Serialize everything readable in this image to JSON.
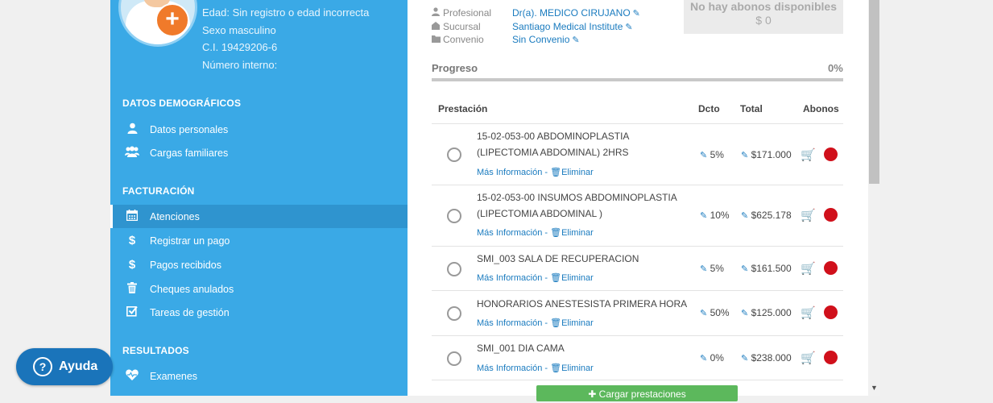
{
  "patient": {
    "edad": "Edad: Sin registro o edad incorrecta",
    "sexo": "Sexo masculino",
    "ci": "C.I. 19429206-6",
    "numero_interno": "Número interno:"
  },
  "sidebar": {
    "sections": [
      {
        "title": "DATOS DEMOGRÁFICOS"
      },
      {
        "title": "FACTURACIÓN"
      },
      {
        "title": "RESULTADOS"
      }
    ],
    "items": [
      {
        "label": "Datos personales",
        "icon": "user-icon"
      },
      {
        "label": "Cargas familiares",
        "icon": "users-icon"
      },
      {
        "label": "Atenciones",
        "icon": "calendar-icon",
        "active": true
      },
      {
        "label": "Registrar un pago",
        "icon": "dollar-icon"
      },
      {
        "label": "Pagos recibidos",
        "icon": "dollar-icon"
      },
      {
        "label": "Cheques anulados",
        "icon": "trash-icon"
      },
      {
        "label": "Tareas de gestión",
        "icon": "checkbox-icon"
      },
      {
        "label": "Examenes",
        "icon": "heartbeat-icon"
      }
    ]
  },
  "help": {
    "label": "Ayuda"
  },
  "meta": {
    "profesional_label": "Profesional",
    "profesional_value": "Dr(a). MEDICO CIRUJANO",
    "sucursal_label": "Sucursal",
    "sucursal_value": "Santiago Medical Institute",
    "convenio_label": "Convenio",
    "convenio_value": "Sin Convenio"
  },
  "abonos": {
    "title": "No hay abonos disponibles",
    "amount": "$ 0"
  },
  "progress": {
    "label": "Progreso",
    "percent_text": "0%",
    "value": 0
  },
  "table": {
    "headers": {
      "prestacion": "Prestación",
      "dcto": "Dcto",
      "total": "Total",
      "abonos": "Abonos"
    },
    "link_info": "Más Información",
    "link_delete": "Eliminar",
    "rows": [
      {
        "desc": "15-02-053-00 ABDOMINOPLASTIA (LIPECTOMIA ABDOMINAL) 2HRS",
        "dcto": "5%",
        "total": "$171.000"
      },
      {
        "desc": "15-02-053-00 INSUMOS ABDOMINOPLASTIA (LIPECTOMIA ABDOMINAL )",
        "dcto": "10%",
        "total": "$625.178"
      },
      {
        "desc": "SMI_003 SALA DE RECUPERACION",
        "dcto": "5%",
        "total": "$161.500"
      },
      {
        "desc": "HONORARIOS ANESTESISTA PRIMERA HORA",
        "dcto": "50%",
        "total": "$125.000"
      },
      {
        "desc": "SMI_001 DIA CAMA",
        "dcto": "0%",
        "total": "$238.000"
      }
    ]
  },
  "add_button": {
    "label": "Cargar prestaciones"
  },
  "colors": {
    "sidebar": "#3aa9e6",
    "active": "#2f94cf",
    "link": "#1a7bbf",
    "status_red": "#d0101b",
    "button_green": "#5cb85c"
  }
}
